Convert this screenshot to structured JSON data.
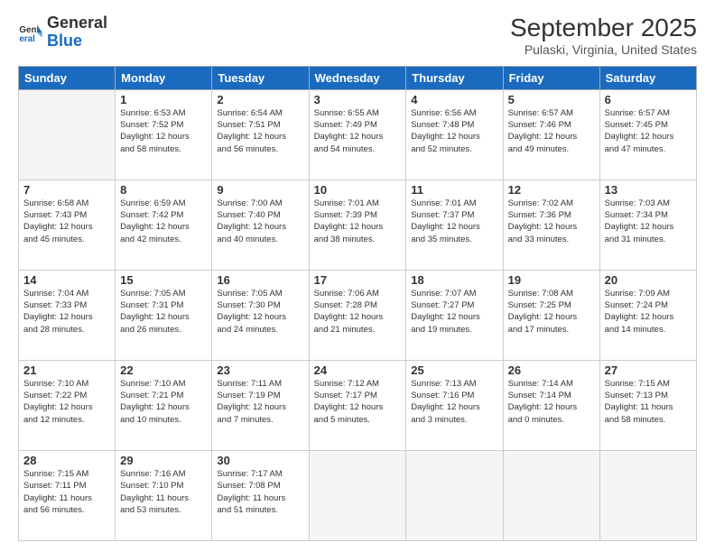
{
  "header": {
    "logo_line1": "General",
    "logo_line2": "Blue",
    "title": "September 2025",
    "subtitle": "Pulaski, Virginia, United States"
  },
  "weekdays": [
    "Sunday",
    "Monday",
    "Tuesday",
    "Wednesday",
    "Thursday",
    "Friday",
    "Saturday"
  ],
  "weeks": [
    [
      {
        "day": "",
        "info": ""
      },
      {
        "day": "1",
        "info": "Sunrise: 6:53 AM\nSunset: 7:52 PM\nDaylight: 12 hours\nand 58 minutes."
      },
      {
        "day": "2",
        "info": "Sunrise: 6:54 AM\nSunset: 7:51 PM\nDaylight: 12 hours\nand 56 minutes."
      },
      {
        "day": "3",
        "info": "Sunrise: 6:55 AM\nSunset: 7:49 PM\nDaylight: 12 hours\nand 54 minutes."
      },
      {
        "day": "4",
        "info": "Sunrise: 6:56 AM\nSunset: 7:48 PM\nDaylight: 12 hours\nand 52 minutes."
      },
      {
        "day": "5",
        "info": "Sunrise: 6:57 AM\nSunset: 7:46 PM\nDaylight: 12 hours\nand 49 minutes."
      },
      {
        "day": "6",
        "info": "Sunrise: 6:57 AM\nSunset: 7:45 PM\nDaylight: 12 hours\nand 47 minutes."
      }
    ],
    [
      {
        "day": "7",
        "info": "Sunrise: 6:58 AM\nSunset: 7:43 PM\nDaylight: 12 hours\nand 45 minutes."
      },
      {
        "day": "8",
        "info": "Sunrise: 6:59 AM\nSunset: 7:42 PM\nDaylight: 12 hours\nand 42 minutes."
      },
      {
        "day": "9",
        "info": "Sunrise: 7:00 AM\nSunset: 7:40 PM\nDaylight: 12 hours\nand 40 minutes."
      },
      {
        "day": "10",
        "info": "Sunrise: 7:01 AM\nSunset: 7:39 PM\nDaylight: 12 hours\nand 38 minutes."
      },
      {
        "day": "11",
        "info": "Sunrise: 7:01 AM\nSunset: 7:37 PM\nDaylight: 12 hours\nand 35 minutes."
      },
      {
        "day": "12",
        "info": "Sunrise: 7:02 AM\nSunset: 7:36 PM\nDaylight: 12 hours\nand 33 minutes."
      },
      {
        "day": "13",
        "info": "Sunrise: 7:03 AM\nSunset: 7:34 PM\nDaylight: 12 hours\nand 31 minutes."
      }
    ],
    [
      {
        "day": "14",
        "info": "Sunrise: 7:04 AM\nSunset: 7:33 PM\nDaylight: 12 hours\nand 28 minutes."
      },
      {
        "day": "15",
        "info": "Sunrise: 7:05 AM\nSunset: 7:31 PM\nDaylight: 12 hours\nand 26 minutes."
      },
      {
        "day": "16",
        "info": "Sunrise: 7:05 AM\nSunset: 7:30 PM\nDaylight: 12 hours\nand 24 minutes."
      },
      {
        "day": "17",
        "info": "Sunrise: 7:06 AM\nSunset: 7:28 PM\nDaylight: 12 hours\nand 21 minutes."
      },
      {
        "day": "18",
        "info": "Sunrise: 7:07 AM\nSunset: 7:27 PM\nDaylight: 12 hours\nand 19 minutes."
      },
      {
        "day": "19",
        "info": "Sunrise: 7:08 AM\nSunset: 7:25 PM\nDaylight: 12 hours\nand 17 minutes."
      },
      {
        "day": "20",
        "info": "Sunrise: 7:09 AM\nSunset: 7:24 PM\nDaylight: 12 hours\nand 14 minutes."
      }
    ],
    [
      {
        "day": "21",
        "info": "Sunrise: 7:10 AM\nSunset: 7:22 PM\nDaylight: 12 hours\nand 12 minutes."
      },
      {
        "day": "22",
        "info": "Sunrise: 7:10 AM\nSunset: 7:21 PM\nDaylight: 12 hours\nand 10 minutes."
      },
      {
        "day": "23",
        "info": "Sunrise: 7:11 AM\nSunset: 7:19 PM\nDaylight: 12 hours\nand 7 minutes."
      },
      {
        "day": "24",
        "info": "Sunrise: 7:12 AM\nSunset: 7:17 PM\nDaylight: 12 hours\nand 5 minutes."
      },
      {
        "day": "25",
        "info": "Sunrise: 7:13 AM\nSunset: 7:16 PM\nDaylight: 12 hours\nand 3 minutes."
      },
      {
        "day": "26",
        "info": "Sunrise: 7:14 AM\nSunset: 7:14 PM\nDaylight: 12 hours\nand 0 minutes."
      },
      {
        "day": "27",
        "info": "Sunrise: 7:15 AM\nSunset: 7:13 PM\nDaylight: 11 hours\nand 58 minutes."
      }
    ],
    [
      {
        "day": "28",
        "info": "Sunrise: 7:15 AM\nSunset: 7:11 PM\nDaylight: 11 hours\nand 56 minutes."
      },
      {
        "day": "29",
        "info": "Sunrise: 7:16 AM\nSunset: 7:10 PM\nDaylight: 11 hours\nand 53 minutes."
      },
      {
        "day": "30",
        "info": "Sunrise: 7:17 AM\nSunset: 7:08 PM\nDaylight: 11 hours\nand 51 minutes."
      },
      {
        "day": "",
        "info": ""
      },
      {
        "day": "",
        "info": ""
      },
      {
        "day": "",
        "info": ""
      },
      {
        "day": "",
        "info": ""
      }
    ]
  ]
}
